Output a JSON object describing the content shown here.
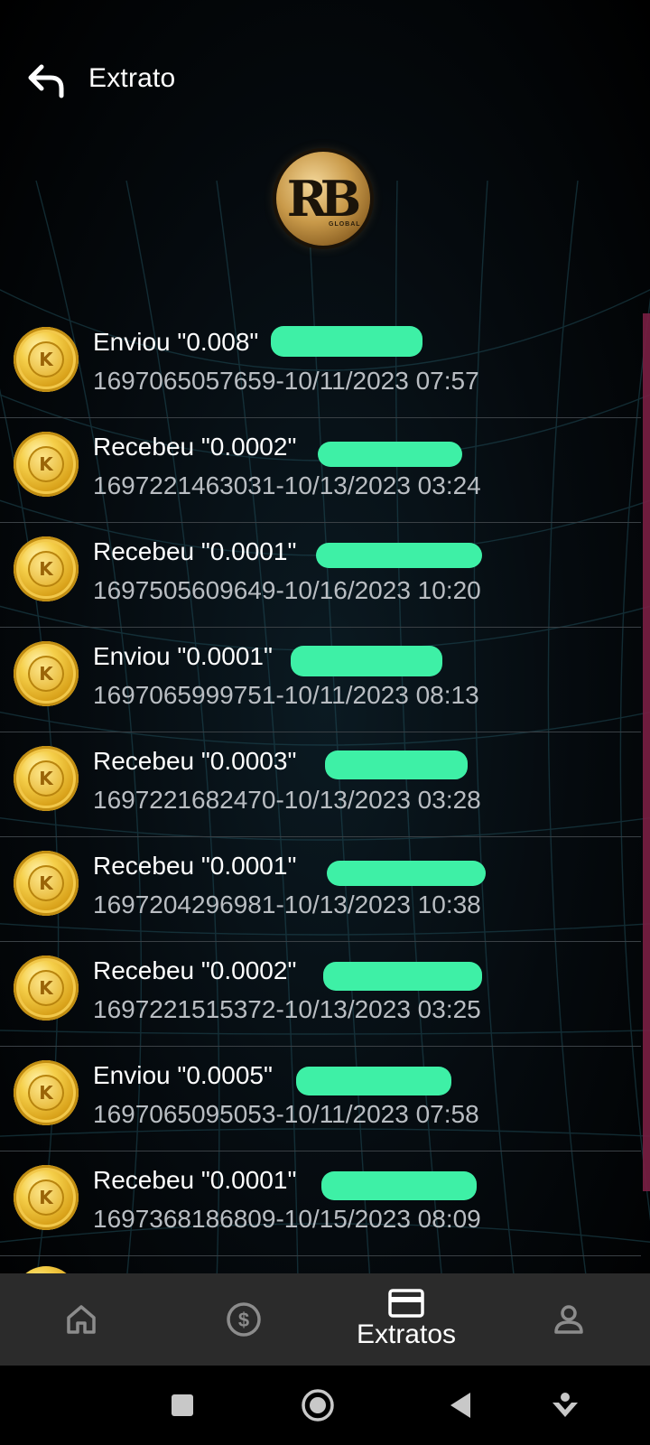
{
  "header": {
    "title": "Extrato",
    "back_icon": "back-arrow-icon"
  },
  "logo": {
    "mark": "RB",
    "sub": "GLOBAL"
  },
  "colors": {
    "redaction": "#3ef0a6",
    "accent_scroll": "#7a1f44",
    "nav_bg": "#2b2b2b"
  },
  "transactions": [
    {
      "desc": "Enviou \"0.008\"",
      "meta": "1697065057659-10/11/2023 07:57"
    },
    {
      "desc": "Recebeu \"0.0002\"",
      "meta": "1697221463031-10/13/2023 03:24"
    },
    {
      "desc": "Recebeu \"0.0001\"",
      "meta": "1697505609649-10/16/2023 10:20"
    },
    {
      "desc": "Enviou \"0.0001\"",
      "meta": "1697065999751-10/11/2023 08:13"
    },
    {
      "desc": "Recebeu \"0.0003\"",
      "meta": "1697221682470-10/13/2023 03:28"
    },
    {
      "desc": "Recebeu \"0.0001\"",
      "meta": "1697204296981-10/13/2023 10:38"
    },
    {
      "desc": "Recebeu \"0.0002\"",
      "meta": "1697221515372-10/13/2023 03:25"
    },
    {
      "desc": "Enviou \"0.0005\"",
      "meta": "1697065095053-10/11/2023 07:58"
    },
    {
      "desc": "Recebeu \"0.0001\"",
      "meta": "1697368186809-10/15/2023 08:09"
    }
  ],
  "bottom_nav": {
    "home_icon": "home-icon",
    "money_icon": "dollar-circle-icon",
    "statements_label": "Extratos",
    "statements_icon": "card-icon",
    "profile_icon": "user-icon"
  }
}
